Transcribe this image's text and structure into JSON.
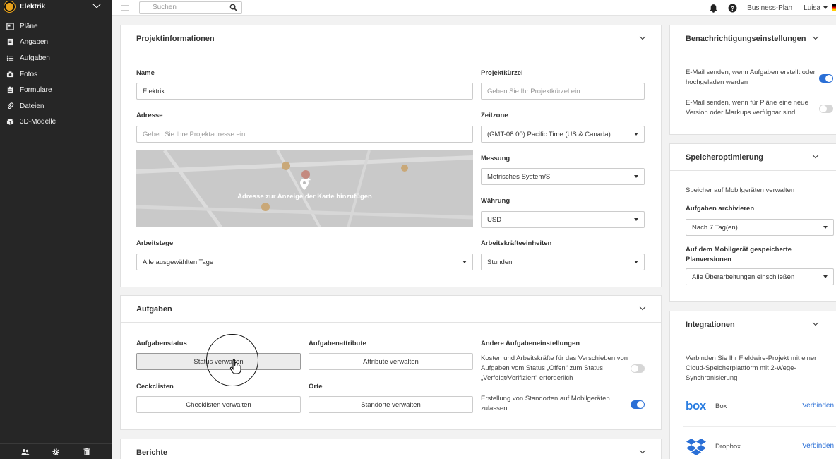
{
  "sidebar": {
    "project_name": "Elektrik",
    "items": [
      {
        "label": "Pläne",
        "icon": "plans-icon"
      },
      {
        "label": "Angaben",
        "icon": "specs-icon"
      },
      {
        "label": "Aufgaben",
        "icon": "tasks-icon"
      },
      {
        "label": "Fotos",
        "icon": "camera-icon"
      },
      {
        "label": "Formulare",
        "icon": "forms-icon"
      },
      {
        "label": "Dateien",
        "icon": "paperclip-icon"
      },
      {
        "label": "3D-Modelle",
        "icon": "cube-icon"
      }
    ]
  },
  "topbar": {
    "search_placeholder": "Suchen",
    "plan": "Business-Plan",
    "user": "Luisa"
  },
  "project_info": {
    "title": "Projektinformationen",
    "name_label": "Name",
    "name_value": "Elektrik",
    "code_label": "Projektkürzel",
    "code_placeholder": "Geben Sie Ihr Projektkürzel ein",
    "address_label": "Adresse",
    "address_placeholder": "Geben Sie Ihre Projektadresse ein",
    "map_text": "Adresse zur Anzeige der Karte hinzufügen",
    "timezone_label": "Zeitzone",
    "timezone_value": "(GMT-08:00) Pacific Time (US & Canada)",
    "measure_label": "Messung",
    "measure_value": "Metrisches System/SI",
    "currency_label": "Währung",
    "currency_value": "USD",
    "workdays_label": "Arbeitstage",
    "workdays_value": "Alle ausgewählten Tage",
    "labor_label": "Arbeitskräfteeinheiten",
    "labor_value": "Stunden"
  },
  "tasks": {
    "title": "Aufgaben",
    "status_label": "Aufgabenstatus",
    "status_button": "Status verwalten",
    "attr_label": "Aufgabenattribute",
    "attr_button": "Attribute verwalten",
    "checklist_label": "Ceckclisten",
    "checklist_button": "Checklisten verwalten",
    "places_label": "Orte",
    "places_button": "Standorte verwalten",
    "other_label": "Andere Aufgabeneinstellungen",
    "other_setting1": "Kosten und Arbeitskräfte für das Verschieben von Aufgaben vom Status „Offen“ zum Status „Verfolgt/Verifiziert“ erforderlich",
    "other_setting2": "Erstellung von Standorten auf Mobilgeräten zulassen"
  },
  "reports": {
    "title": "Berichte"
  },
  "notifications": {
    "title": "Benachrichtigungseinstellungen",
    "setting1": "E-Mail senden, wenn Aufgaben erstellt oder hochgeladen werden",
    "setting2": "E-Mail senden, wenn für Pläne eine neue Version oder Markups verfügbar sind"
  },
  "storage": {
    "title": "Speicheroptimierung",
    "subtitle": "Speicher auf Mobilgeräten verwalten",
    "archive_label": "Aufgaben archivieren",
    "archive_value": "Nach 7 Tag(en)",
    "versions_label": "Auf dem Mobilgerät gespeicherte Planversionen",
    "versions_value": "Alle Überarbeitungen einschließen"
  },
  "integrations": {
    "title": "Integrationen",
    "description": "Verbinden Sie Ihr Fieldwire-Projekt mit einer Cloud-Speicherplattform mit 2-Wege-Synchronisierung",
    "box_logo": "box",
    "box_name": "Box",
    "dropbox_name": "Dropbox",
    "connect": "Verbinden"
  },
  "colors": {
    "accent": "#2a6fd6",
    "sidebar": "#262626",
    "logo": "#e8a21c"
  }
}
